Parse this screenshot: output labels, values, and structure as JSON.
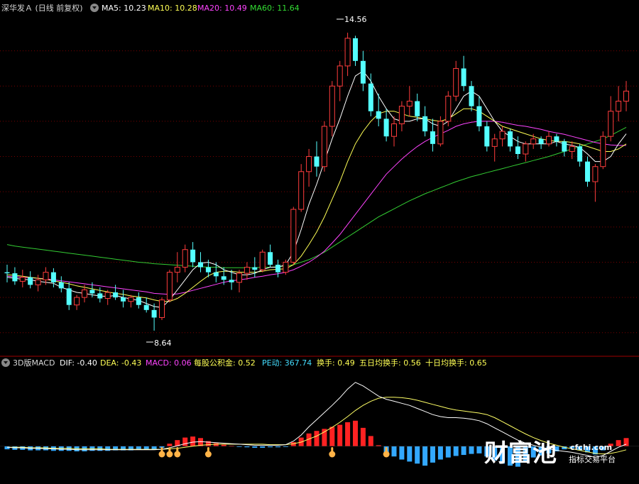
{
  "colors": {
    "up": "#ff3d3d",
    "down": "#54ffff",
    "ma5": "#ffffff",
    "ma10": "#ffff55",
    "ma20": "#ff44ff",
    "ma60": "#33cc33",
    "grid": "#7a0000",
    "macd_pos": "#ff2222",
    "macd_neg": "#33a8ff",
    "hand": "#ffb347"
  },
  "main_header": {
    "title": "深华发Ａ (日线 前复权)",
    "ma5": "MA5: 10.23",
    "ma10": "MA10: 10.28",
    "ma20": "MA20: 10.49",
    "ma60": "MA60: 11.64"
  },
  "sub_header": {
    "title": "3D版MACD",
    "dif": "DIF: -0.40",
    "dea": "DEA: -0.43",
    "macd": "MACD: 0.06",
    "fund": "每股公积金: 0.52",
    "pe": "PE动: 367.74",
    "turnover": "换手: 0.49",
    "turnover5": "五日均换手: 0.56",
    "turnover10": "十日均换手: 0.65"
  },
  "annotations": {
    "high": "14.56",
    "low": "8.64"
  },
  "watermark": {
    "brand": "财富池",
    "domain": "cfchi.com",
    "slogan": "指标交易平台"
  },
  "chart_data": {
    "type": "candlestick",
    "ylim": [
      8.3,
      14.9
    ],
    "grid_levels": [
      14.2,
      13.5,
      12.8,
      12.1,
      11.4,
      10.7,
      10.0,
      9.3,
      8.6
    ],
    "candles": [
      [
        9.8,
        9.95,
        9.6,
        9.78
      ],
      [
        9.78,
        9.9,
        9.55,
        9.62
      ],
      [
        9.62,
        9.85,
        9.5,
        9.7
      ],
      [
        9.7,
        9.82,
        9.48,
        9.55
      ],
      [
        9.55,
        9.75,
        9.42,
        9.65
      ],
      [
        9.65,
        9.9,
        9.55,
        9.8
      ],
      [
        9.8,
        9.88,
        9.5,
        9.6
      ],
      [
        9.6,
        9.72,
        9.4,
        9.48
      ],
      [
        9.48,
        9.6,
        9.05,
        9.15
      ],
      [
        9.15,
        9.35,
        9.05,
        9.3
      ],
      [
        9.3,
        9.55,
        9.2,
        9.45
      ],
      [
        9.45,
        9.6,
        9.3,
        9.38
      ],
      [
        9.38,
        9.5,
        9.2,
        9.28
      ],
      [
        9.28,
        9.45,
        9.15,
        9.4
      ],
      [
        9.4,
        9.55,
        9.25,
        9.3
      ],
      [
        9.3,
        9.45,
        9.1,
        9.22
      ],
      [
        9.22,
        9.35,
        9.1,
        9.3
      ],
      [
        9.3,
        9.4,
        9.08,
        9.15
      ],
      [
        9.15,
        9.3,
        9.0,
        9.05
      ],
      [
        9.05,
        9.18,
        8.64,
        8.9
      ],
      [
        8.9,
        9.3,
        8.85,
        9.25
      ],
      [
        9.25,
        9.85,
        9.2,
        9.8
      ],
      [
        9.8,
        10.2,
        9.6,
        9.9
      ],
      [
        9.9,
        10.35,
        9.8,
        10.25
      ],
      [
        10.25,
        10.4,
        9.9,
        10.0
      ],
      [
        10.0,
        10.2,
        9.8,
        9.9
      ],
      [
        9.9,
        10.05,
        9.7,
        9.8
      ],
      [
        9.8,
        10.0,
        9.6,
        9.72
      ],
      [
        9.72,
        9.9,
        9.55,
        9.65
      ],
      [
        9.65,
        9.85,
        9.45,
        9.6
      ],
      [
        9.6,
        9.85,
        9.4,
        9.78
      ],
      [
        9.78,
        10.0,
        9.65,
        9.9
      ],
      [
        9.9,
        10.1,
        9.7,
        9.85
      ],
      [
        9.85,
        10.25,
        9.8,
        10.2
      ],
      [
        10.2,
        10.35,
        9.9,
        9.95
      ],
      [
        9.95,
        10.05,
        9.7,
        9.8
      ],
      [
        9.8,
        10.05,
        9.75,
        10.0
      ],
      [
        10.0,
        11.1,
        9.95,
        11.05
      ],
      [
        11.05,
        11.95,
        11.0,
        11.8
      ],
      [
        11.8,
        12.25,
        11.5,
        12.1
      ],
      [
        12.1,
        12.4,
        11.7,
        11.9
      ],
      [
        11.9,
        12.8,
        11.8,
        12.7
      ],
      [
        12.7,
        13.6,
        12.5,
        13.5
      ],
      [
        13.5,
        14.0,
        13.2,
        13.9
      ],
      [
        13.9,
        14.56,
        13.7,
        14.45
      ],
      [
        14.45,
        14.5,
        13.9,
        14.0
      ],
      [
        14.0,
        14.2,
        13.4,
        13.55
      ],
      [
        13.55,
        13.75,
        12.9,
        13.0
      ],
      [
        13.0,
        13.35,
        12.7,
        12.85
      ],
      [
        12.85,
        13.05,
        12.4,
        12.5
      ],
      [
        12.5,
        12.9,
        12.3,
        12.75
      ],
      [
        12.75,
        13.2,
        12.6,
        13.1
      ],
      [
        13.1,
        13.5,
        12.9,
        13.2
      ],
      [
        13.2,
        13.35,
        12.8,
        12.9
      ],
      [
        12.9,
        13.1,
        12.5,
        12.6
      ],
      [
        12.6,
        12.85,
        12.2,
        12.35
      ],
      [
        12.35,
        12.9,
        12.3,
        12.8
      ],
      [
        12.8,
        13.4,
        12.7,
        13.3
      ],
      [
        13.3,
        14.0,
        13.2,
        13.85
      ],
      [
        13.85,
        14.1,
        13.4,
        13.5
      ],
      [
        13.5,
        13.6,
        13.0,
        13.1
      ],
      [
        13.1,
        13.3,
        12.6,
        12.7
      ],
      [
        12.7,
        12.8,
        12.2,
        12.3
      ],
      [
        12.3,
        12.55,
        12.0,
        12.45
      ],
      [
        12.45,
        12.7,
        12.3,
        12.6
      ],
      [
        12.6,
        12.65,
        12.2,
        12.3
      ],
      [
        12.3,
        12.5,
        12.05,
        12.15
      ],
      [
        12.15,
        12.4,
        12.0,
        12.35
      ],
      [
        12.35,
        12.55,
        12.25,
        12.45
      ],
      [
        12.45,
        12.5,
        12.25,
        12.35
      ],
      [
        12.35,
        12.6,
        12.3,
        12.5
      ],
      [
        12.5,
        12.55,
        12.3,
        12.4
      ],
      [
        12.4,
        12.45,
        12.1,
        12.2
      ],
      [
        12.2,
        12.4,
        12.05,
        12.3
      ],
      [
        12.3,
        12.35,
        11.9,
        12.0
      ],
      [
        12.0,
        12.1,
        11.5,
        11.6
      ],
      [
        11.6,
        11.95,
        11.2,
        11.9
      ],
      [
        11.9,
        12.6,
        11.85,
        12.5
      ],
      [
        12.5,
        13.3,
        12.4,
        13.0
      ],
      [
        13.0,
        13.5,
        12.8,
        13.2
      ],
      [
        13.2,
        13.6,
        13.0,
        13.4
      ]
    ],
    "ma5": [
      9.7,
      9.68,
      9.66,
      9.65,
      9.62,
      9.6,
      9.58,
      9.5,
      9.45,
      9.4,
      9.38,
      9.35,
      9.33,
      9.32,
      9.34,
      9.3,
      9.27,
      9.24,
      9.18,
      9.12,
      9.1,
      9.25,
      9.45,
      9.65,
      9.85,
      9.98,
      10.0,
      9.95,
      9.85,
      9.8,
      9.75,
      9.75,
      9.78,
      9.85,
      9.9,
      9.9,
      9.95,
      10.2,
      10.65,
      11.15,
      11.55,
      12.0,
      12.45,
      12.85,
      13.3,
      13.7,
      13.8,
      13.6,
      13.3,
      13.05,
      12.85,
      12.8,
      12.8,
      12.85,
      12.85,
      12.75,
      12.7,
      12.8,
      13.05,
      13.3,
      13.4,
      13.3,
      13.05,
      12.8,
      12.6,
      12.5,
      12.4,
      12.35,
      12.35,
      12.35,
      12.35,
      12.4,
      12.35,
      12.32,
      12.28,
      12.15,
      12.0,
      12.0,
      12.1,
      12.35,
      12.55
    ],
    "ma10": [
      9.75,
      9.74,
      9.72,
      9.7,
      9.68,
      9.66,
      9.63,
      9.6,
      9.57,
      9.53,
      9.5,
      9.47,
      9.44,
      9.41,
      9.38,
      9.36,
      9.33,
      9.31,
      9.29,
      9.25,
      9.22,
      9.22,
      9.28,
      9.38,
      9.5,
      9.62,
      9.73,
      9.8,
      9.82,
      9.82,
      9.8,
      9.8,
      9.8,
      9.82,
      9.85,
      9.86,
      9.87,
      9.95,
      10.12,
      10.35,
      10.6,
      10.9,
      11.25,
      11.6,
      12.0,
      12.35,
      12.6,
      12.8,
      12.95,
      13.0,
      13.0,
      12.95,
      12.9,
      12.88,
      12.85,
      12.82,
      12.8,
      12.85,
      12.95,
      13.05,
      13.05,
      13.0,
      12.9,
      12.8,
      12.7,
      12.65,
      12.6,
      12.55,
      12.5,
      12.45,
      12.42,
      12.4,
      12.4,
      12.38,
      12.35,
      12.3,
      12.25,
      12.2,
      12.2,
      12.25,
      12.35
    ],
    "ma20": [
      9.72,
      9.71,
      9.7,
      9.69,
      9.68,
      9.67,
      9.65,
      9.63,
      9.61,
      9.59,
      9.57,
      9.55,
      9.53,
      9.51,
      9.49,
      9.47,
      9.45,
      9.43,
      9.41,
      9.38,
      9.37,
      9.36,
      9.37,
      9.4,
      9.44,
      9.48,
      9.52,
      9.56,
      9.6,
      9.63,
      9.65,
      9.67,
      9.7,
      9.72,
      9.75,
      9.77,
      9.8,
      9.85,
      9.92,
      10.0,
      10.1,
      10.22,
      10.38,
      10.55,
      10.75,
      10.95,
      11.15,
      11.35,
      11.55,
      11.75,
      11.9,
      12.05,
      12.18,
      12.3,
      12.4,
      12.48,
      12.55,
      12.62,
      12.7,
      12.75,
      12.78,
      12.8,
      12.8,
      12.8,
      12.78,
      12.75,
      12.72,
      12.7,
      12.67,
      12.64,
      12.6,
      12.57,
      12.54,
      12.5,
      12.46,
      12.42,
      12.38,
      12.35,
      12.33,
      12.32,
      12.32
    ],
    "ma60": [
      10.35,
      10.32,
      10.3,
      10.28,
      10.26,
      10.24,
      10.22,
      10.2,
      10.18,
      10.16,
      10.14,
      10.12,
      10.1,
      10.08,
      10.06,
      10.04,
      10.02,
      10.0,
      9.99,
      9.97,
      9.96,
      9.95,
      9.94,
      9.93,
      9.92,
      9.91,
      9.9,
      9.9,
      9.89,
      9.89,
      9.89,
      9.89,
      9.89,
      9.9,
      9.9,
      9.91,
      9.92,
      9.95,
      10.0,
      10.05,
      10.12,
      10.2,
      10.3,
      10.4,
      10.5,
      10.6,
      10.7,
      10.8,
      10.9,
      10.98,
      11.06,
      11.14,
      11.22,
      11.29,
      11.36,
      11.42,
      11.48,
      11.54,
      11.6,
      11.65,
      11.7,
      11.74,
      11.78,
      11.82,
      11.86,
      11.9,
      11.94,
      11.98,
      12.02,
      12.06,
      12.1,
      12.15,
      12.2,
      12.25,
      12.3,
      12.35,
      12.4,
      12.45,
      12.52,
      12.6,
      12.68
    ],
    "macd_hist": [
      -0.06,
      -0.07,
      -0.07,
      -0.08,
      -0.08,
      -0.08,
      -0.09,
      -0.09,
      -0.09,
      -0.1,
      -0.1,
      -0.09,
      -0.09,
      -0.09,
      -0.08,
      -0.08,
      -0.08,
      -0.07,
      -0.07,
      -0.06,
      -0.03,
      0.05,
      0.12,
      0.17,
      0.19,
      0.16,
      0.1,
      0.06,
      0.03,
      0.01,
      -0.01,
      -0.02,
      -0.03,
      -0.03,
      -0.02,
      -0.02,
      -0.01,
      0.08,
      0.17,
      0.25,
      0.3,
      0.34,
      0.38,
      0.42,
      0.47,
      0.5,
      0.36,
      0.2,
      0.02,
      -0.12,
      -0.2,
      -0.26,
      -0.3,
      -0.34,
      -0.38,
      -0.32,
      -0.26,
      -0.22,
      -0.19,
      -0.17,
      -0.15,
      -0.14,
      -0.2,
      -0.28,
      -0.34,
      -0.38,
      -0.4,
      -0.3,
      -0.22,
      -0.18,
      -0.14,
      -0.1,
      -0.06,
      -0.04,
      -0.08,
      -0.12,
      -0.16,
      -0.08,
      0.05,
      0.12,
      0.16
    ],
    "dif": [
      -0.02,
      -0.03,
      -0.03,
      -0.04,
      -0.04,
      -0.05,
      -0.05,
      -0.06,
      -0.06,
      -0.07,
      -0.07,
      -0.07,
      -0.07,
      -0.07,
      -0.07,
      -0.07,
      -0.07,
      -0.07,
      -0.07,
      -0.07,
      -0.06,
      -0.03,
      0.01,
      0.05,
      0.08,
      0.09,
      0.08,
      0.07,
      0.06,
      0.05,
      0.04,
      0.03,
      0.02,
      0.02,
      0.02,
      0.02,
      0.03,
      0.1,
      0.22,
      0.38,
      0.52,
      0.66,
      0.8,
      0.95,
      1.12,
      1.25,
      1.18,
      1.08,
      0.98,
      0.92,
      0.88,
      0.84,
      0.8,
      0.74,
      0.68,
      0.62,
      0.58,
      0.56,
      0.56,
      0.55,
      0.53,
      0.5,
      0.44,
      0.36,
      0.28,
      0.2,
      0.12,
      0.06,
      0.02,
      -0.02,
      -0.05,
      -0.08,
      -0.1,
      -0.12,
      -0.15,
      -0.18,
      -0.22,
      -0.18,
      -0.1,
      -0.02,
      0.04
    ],
    "dea": [
      -0.02,
      -0.02,
      -0.02,
      -0.03,
      -0.03,
      -0.03,
      -0.04,
      -0.04,
      -0.04,
      -0.05,
      -0.05,
      -0.05,
      -0.05,
      -0.06,
      -0.06,
      -0.06,
      -0.06,
      -0.06,
      -0.06,
      -0.06,
      -0.06,
      -0.05,
      -0.04,
      -0.02,
      0.0,
      0.02,
      0.03,
      0.04,
      0.04,
      0.04,
      0.04,
      0.04,
      0.04,
      0.04,
      0.03,
      0.03,
      0.03,
      0.05,
      0.08,
      0.14,
      0.2,
      0.28,
      0.37,
      0.47,
      0.58,
      0.7,
      0.8,
      0.88,
      0.94,
      0.96,
      0.96,
      0.95,
      0.93,
      0.9,
      0.86,
      0.82,
      0.78,
      0.74,
      0.71,
      0.69,
      0.67,
      0.65,
      0.62,
      0.56,
      0.48,
      0.4,
      0.32,
      0.24,
      0.17,
      0.11,
      0.06,
      0.02,
      -0.02,
      -0.05,
      -0.08,
      -0.11,
      -0.14,
      -0.15,
      -0.14,
      -0.11,
      -0.07
    ],
    "signals": [
      20,
      21,
      22,
      26,
      42,
      49
    ],
    "macd_ylim": [
      -0.6,
      1.4
    ]
  }
}
